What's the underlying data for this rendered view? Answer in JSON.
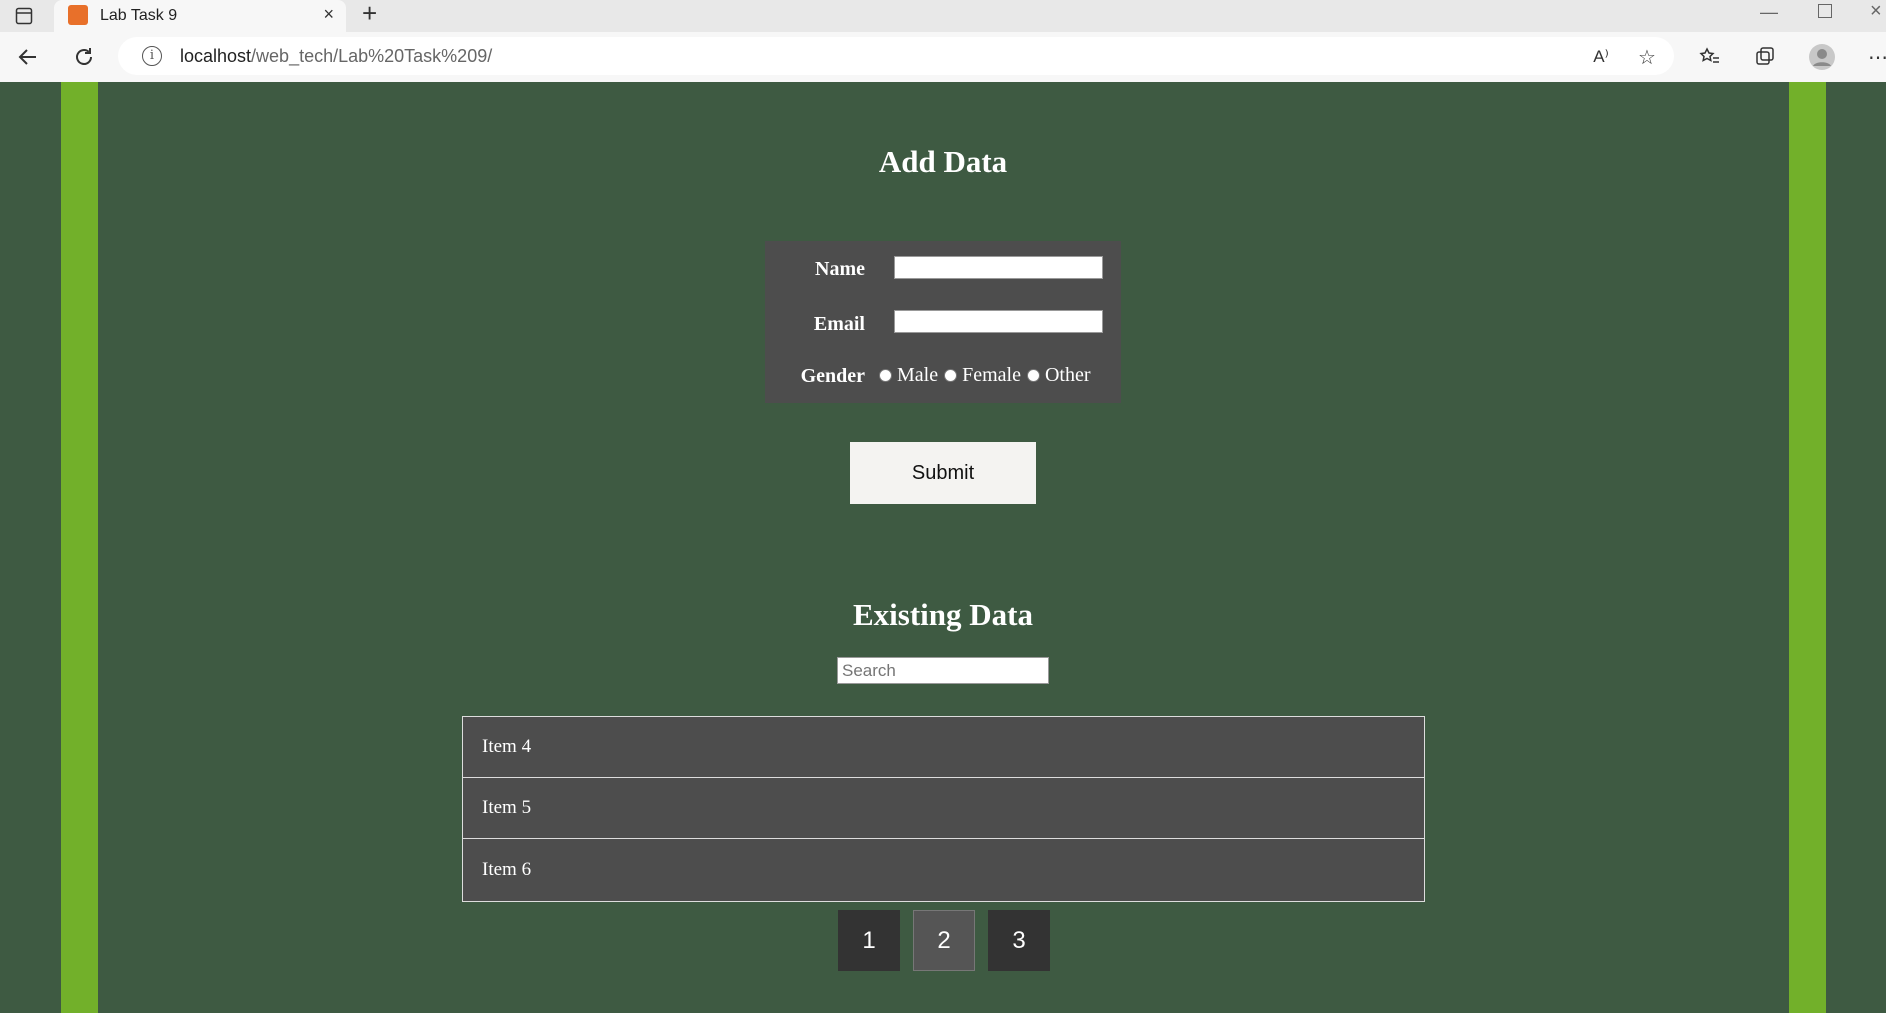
{
  "browser": {
    "tab_title": "Lab Task 9",
    "new_tab": "+",
    "tab_close": "×",
    "url_host": "localhost",
    "url_path": "/web_tech/Lab%20Task%209/",
    "read_aloud_label": "A⁾"
  },
  "form": {
    "heading": "Add Data",
    "name_label": "Name",
    "email_label": "Email",
    "gender_label": "Gender",
    "gender_options": [
      "Male",
      "Female",
      "Other"
    ],
    "submit_label": "Submit"
  },
  "existing": {
    "heading": "Existing Data",
    "search_placeholder": "Search",
    "items": [
      "Item 4",
      "Item 5",
      "Item 6"
    ],
    "pages": [
      "1",
      "2",
      "3"
    ],
    "current_page": "2"
  },
  "colors": {
    "background": "#3e5a42",
    "stripe": "#72b02a",
    "panel": "#4d4d4d"
  }
}
